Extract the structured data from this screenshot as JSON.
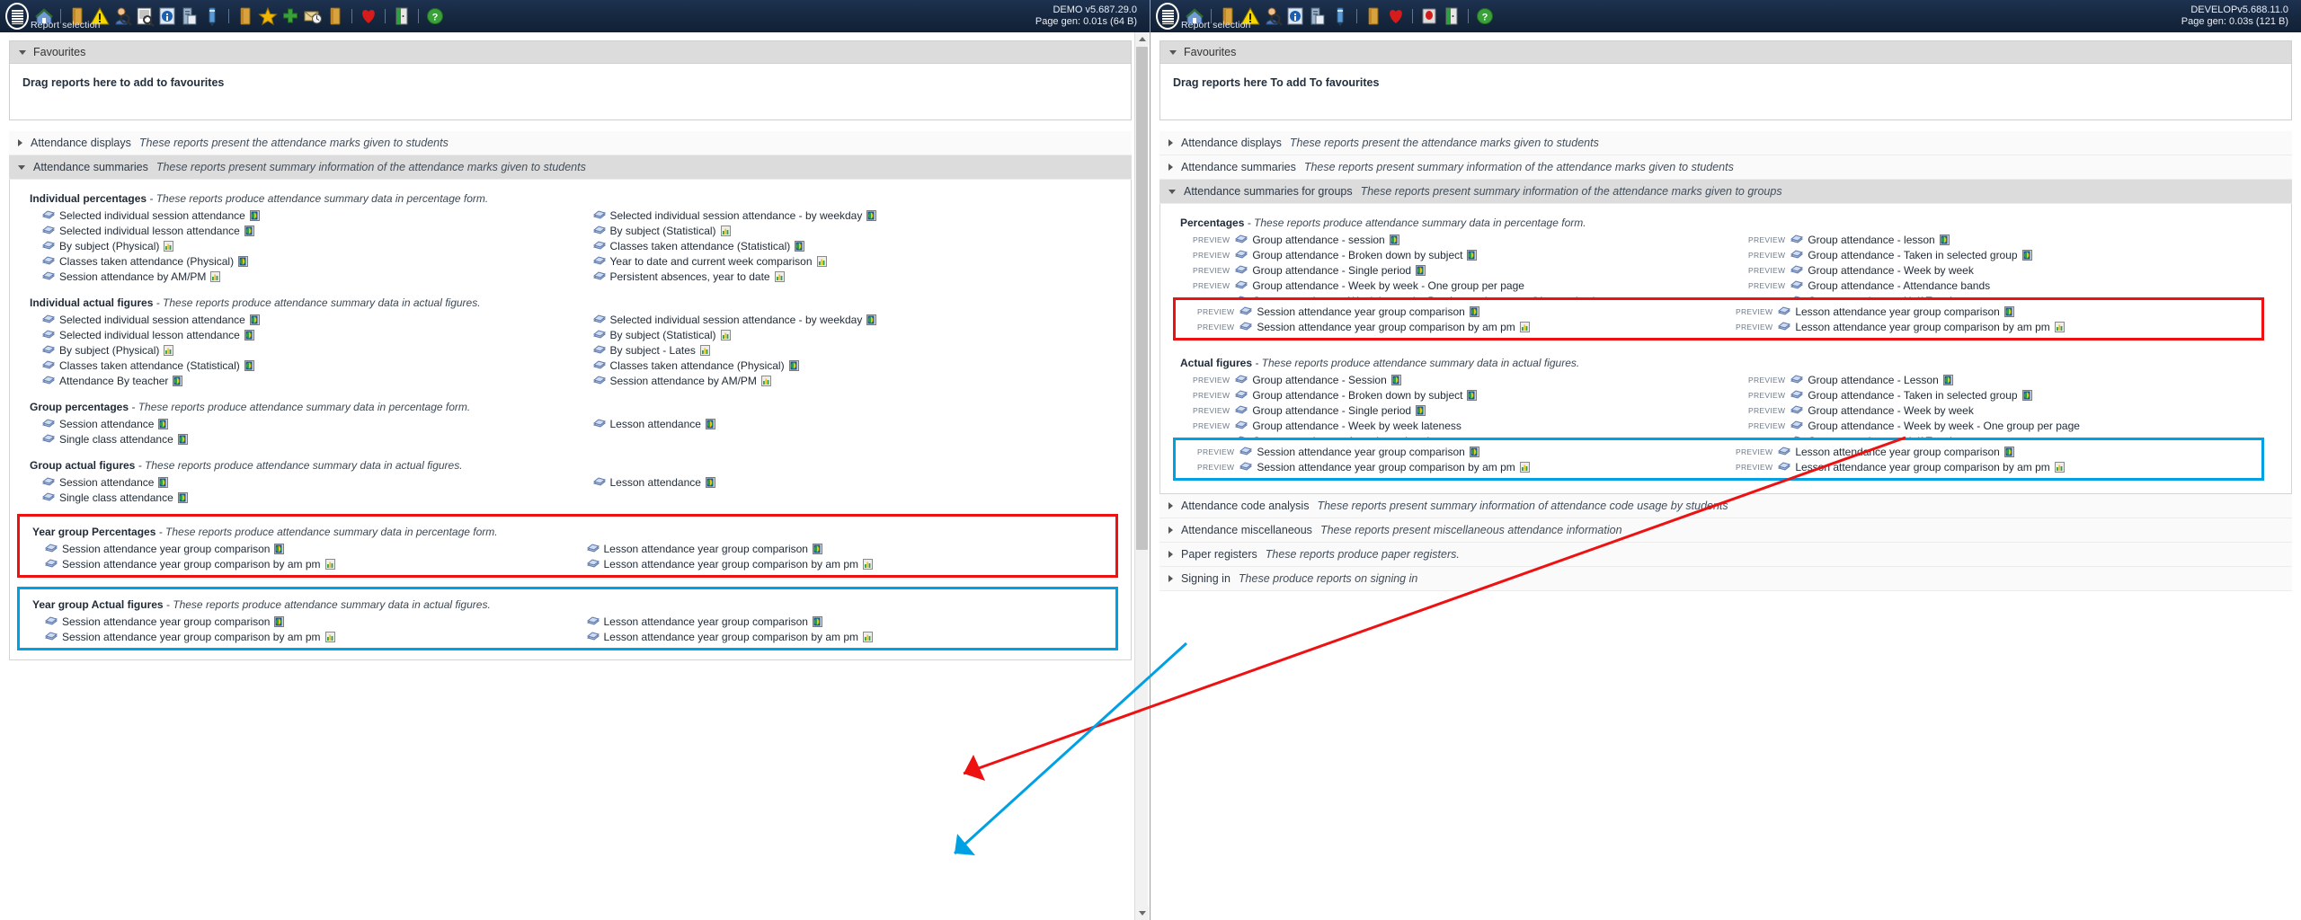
{
  "toolbar": {
    "report_selection_label": "Report selection",
    "left": {
      "version": "DEMO v5.687.29.0",
      "pagegen": "Page gen: 0.01s (64 B)"
    },
    "right": {
      "version": "DEVELOPv5.688.11.0",
      "pagegen": "Page gen: 0.03s (121 B)"
    },
    "icons": [
      "menu-icon",
      "home-icon",
      "book-icon",
      "warning-icon",
      "student-search-icon",
      "register-search-icon",
      "info-icon",
      "server-icon",
      "pen-icon",
      "folder-icon",
      "star-icon",
      "plus-icon",
      "clock-mail-icon",
      "folder2-icon",
      "heart-icon",
      "exit-door-icon",
      "help-icon"
    ],
    "icons_right": [
      "menu-icon",
      "home-icon",
      "book-icon",
      "warning-icon",
      "student-search-icon",
      "info-icon",
      "server-icon",
      "pen-icon",
      "folder-icon",
      "heart-icon",
      "stop-icon",
      "exit-door-icon",
      "help-icon"
    ]
  },
  "favourites": {
    "title": "Favourites",
    "left_message": "Drag reports here to add to favourites",
    "right_message": "Drag reports here To add To favourites"
  },
  "colors": {
    "highlight_red": "#ee1111",
    "highlight_blue": "#00a0e4",
    "header_open": "#dcdcdc",
    "header_closed": "#fafafa",
    "toolbar_bg": "#16273f"
  },
  "left_panel": {
    "accordions": [
      {
        "name": "Attendance displays",
        "desc": "These reports present the attendance marks given to students",
        "open": false
      },
      {
        "name": "Attendance summaries",
        "desc": "These reports present summary information of the attendance marks given to students",
        "open": true
      }
    ],
    "groups": [
      {
        "id": "individual-percentages",
        "title": "Individual percentages",
        "desc": "- These reports produce attendance summary data in percentage form.",
        "highlight": "none",
        "left_items": [
          {
            "label": "Selected individual session attendance",
            "icon": "globe-doc-icon"
          },
          {
            "label": "Selected individual lesson attendance",
            "icon": "globe-doc-icon"
          },
          {
            "label": "By subject (Physical)",
            "icon": "bar-chart-icon"
          },
          {
            "label": "Classes taken attendance (Physical)",
            "icon": "globe-doc-icon"
          },
          {
            "label": "Session attendance by AM/PM",
            "icon": "bar-chart-icon"
          }
        ],
        "right_items": [
          {
            "label": "Selected individual session attendance - by weekday",
            "icon": "globe-doc-icon"
          },
          {
            "label": "By subject (Statistical)",
            "icon": "bar-chart-icon"
          },
          {
            "label": "Classes taken attendance (Statistical)",
            "icon": "globe-doc-icon"
          },
          {
            "label": "Year to date and current week comparison",
            "icon": "bar-chart-icon"
          },
          {
            "label": "Persistent absences, year to date",
            "icon": "bar-chart-icon"
          }
        ]
      },
      {
        "id": "individual-actual-figures",
        "title": "Individual actual figures",
        "desc": "- These reports produce attendance summary data in actual figures.",
        "highlight": "none",
        "left_items": [
          {
            "label": "Selected individual session attendance",
            "icon": "globe-doc-icon"
          },
          {
            "label": "Selected individual lesson attendance",
            "icon": "globe-doc-icon"
          },
          {
            "label": "By subject (Physical)",
            "icon": "bar-chart-icon"
          },
          {
            "label": "Classes taken attendance (Statistical)",
            "icon": "globe-doc-icon"
          },
          {
            "label": "Attendance By teacher",
            "icon": "globe-doc-icon"
          }
        ],
        "right_items": [
          {
            "label": "Selected individual session attendance - by weekday",
            "icon": "globe-doc-icon"
          },
          {
            "label": "By subject (Statistical)",
            "icon": "bar-chart-icon"
          },
          {
            "label": "By subject - Lates",
            "icon": "bar-chart-icon"
          },
          {
            "label": "Classes taken attendance (Physical)",
            "icon": "globe-doc-icon"
          },
          {
            "label": "Session attendance by AM/PM",
            "icon": "bar-chart-icon"
          }
        ]
      },
      {
        "id": "group-percentages",
        "title": "Group percentages",
        "desc": "- These reports produce attendance summary data in percentage form.",
        "highlight": "none",
        "left_items": [
          {
            "label": "Session attendance",
            "icon": "globe-doc-icon"
          },
          {
            "label": "Single class attendance",
            "icon": "globe-doc-icon"
          }
        ],
        "right_items": [
          {
            "label": "Lesson attendance",
            "icon": "globe-doc-icon"
          }
        ]
      },
      {
        "id": "group-actual-figures",
        "title": "Group actual figures",
        "desc": "- These reports produce attendance summary data in actual figures.",
        "highlight": "none",
        "left_items": [
          {
            "label": "Session attendance",
            "icon": "globe-doc-icon"
          },
          {
            "label": "Single class attendance",
            "icon": "globe-doc-icon"
          }
        ],
        "right_items": [
          {
            "label": "Lesson attendance",
            "icon": "globe-doc-icon"
          }
        ]
      },
      {
        "id": "year-group-percentages",
        "title": "Year group Percentages",
        "desc": "- These reports produce attendance summary data in percentage form.",
        "highlight": "red",
        "left_items": [
          {
            "label": "Session attendance year group comparison",
            "icon": "globe-doc-icon"
          },
          {
            "label": "Session attendance year group comparison by am pm",
            "icon": "bar-chart-icon"
          }
        ],
        "right_items": [
          {
            "label": "Lesson attendance year group comparison",
            "icon": "globe-doc-icon"
          },
          {
            "label": "Lesson attendance year group comparison by am pm",
            "icon": "bar-chart-icon"
          }
        ]
      },
      {
        "id": "year-group-actual-figures",
        "title": "Year group Actual figures",
        "desc": "- These reports produce attendance summary data in actual figures.",
        "highlight": "blue",
        "left_items": [
          {
            "label": "Session attendance year group comparison",
            "icon": "globe-doc-icon"
          },
          {
            "label": "Session attendance year group comparison by am pm",
            "icon": "bar-chart-icon"
          }
        ],
        "right_items": [
          {
            "label": "Lesson attendance year group comparison",
            "icon": "globe-doc-icon"
          },
          {
            "label": "Lesson attendance year group comparison by am pm",
            "icon": "bar-chart-icon"
          }
        ]
      }
    ]
  },
  "right_panel": {
    "accordions_top": [
      {
        "name": "Attendance displays",
        "desc": "These reports present the attendance marks given to students",
        "open": false
      },
      {
        "name": "Attendance summaries",
        "desc": "These reports present summary information of the attendance marks given to students",
        "open": false
      },
      {
        "name": "Attendance summaries for groups",
        "desc": "These reports present summary information of the attendance marks given to groups",
        "open": true
      }
    ],
    "accordions_bottom": [
      {
        "name": "Attendance code analysis",
        "desc": "These reports present summary information of attendance code usage by students",
        "open": false
      },
      {
        "name": "Attendance miscellaneous",
        "desc": "These reports present miscellaneous attendance information",
        "open": false
      },
      {
        "name": "Paper registers",
        "desc": "These reports produce paper registers.",
        "open": false
      },
      {
        "name": "Signing in",
        "desc": "These produce reports on signing in",
        "open": false
      }
    ],
    "preview_label": "PREVIEW",
    "groups": [
      {
        "id": "percentages",
        "title": "Percentages",
        "desc": "- These reports produce attendance summary data in percentage form.",
        "left_items": [
          {
            "label": "Group attendance - session",
            "icon": "globe-doc-icon"
          },
          {
            "label": "Group attendance - Broken down by subject",
            "icon": "globe-doc-icon"
          },
          {
            "label": "Group attendance - Single period",
            "icon": "globe-doc-icon"
          },
          {
            "label": "Group attendance - Week by week - One group per page",
            "icon": "none"
          },
          {
            "label": "Group attendance - Week by week - Persistent absentees (Year to date)",
            "icon": "none"
          }
        ],
        "right_items": [
          {
            "label": "Group attendance - lesson",
            "icon": "globe-doc-icon"
          },
          {
            "label": "Group attendance - Taken in selected group",
            "icon": "globe-doc-icon"
          },
          {
            "label": "Group attendance - Week by week",
            "icon": "none"
          },
          {
            "label": "Group attendance - Attendance bands",
            "icon": "none"
          },
          {
            "label": "Group attendance - Half Termly",
            "icon": "none"
          }
        ],
        "highlight": "red",
        "hl_left_items": [
          {
            "label": "Session attendance year group comparison",
            "icon": "globe-doc-icon"
          },
          {
            "label": "Session attendance year group comparison by am pm",
            "icon": "bar-chart-icon"
          }
        ],
        "hl_right_items": [
          {
            "label": "Lesson attendance year group comparison",
            "icon": "globe-doc-icon"
          },
          {
            "label": "Lesson attendance year group comparison by am pm",
            "icon": "bar-chart-icon"
          }
        ]
      },
      {
        "id": "actual-figures",
        "title": "Actual figures",
        "desc": "- These reports produce attendance summary data in actual figures.",
        "left_items": [
          {
            "label": "Group attendance - Session",
            "icon": "globe-doc-icon"
          },
          {
            "label": "Group attendance - Broken down by subject",
            "icon": "globe-doc-icon"
          },
          {
            "label": "Group attendance - Single period",
            "icon": "globe-doc-icon"
          },
          {
            "label": "Group attendance - Week by week lateness",
            "icon": "none"
          },
          {
            "label": "Group attendance - Attendance bands",
            "icon": "none"
          }
        ],
        "right_items": [
          {
            "label": "Group attendance - Lesson",
            "icon": "globe-doc-icon"
          },
          {
            "label": "Group attendance - Taken in selected group",
            "icon": "globe-doc-icon"
          },
          {
            "label": "Group attendance - Week by week",
            "icon": "none"
          },
          {
            "label": "Group attendance - Week by week - One group per page",
            "icon": "none"
          },
          {
            "label": "Group attendance - Half Termly",
            "icon": "none"
          }
        ],
        "highlight": "blue",
        "hl_left_items": [
          {
            "label": "Session attendance year group comparison",
            "icon": "globe-doc-icon"
          },
          {
            "label": "Session attendance year group comparison by am pm",
            "icon": "bar-chart-icon"
          }
        ],
        "hl_right_items": [
          {
            "label": "Lesson attendance year group comparison",
            "icon": "globe-doc-icon"
          },
          {
            "label": "Lesson attendance year group comparison by am pm",
            "icon": "bar-chart-icon"
          }
        ]
      }
    ]
  },
  "scrollbar": {
    "up": "scroll-up-arrow",
    "down": "scroll-down-arrow"
  }
}
